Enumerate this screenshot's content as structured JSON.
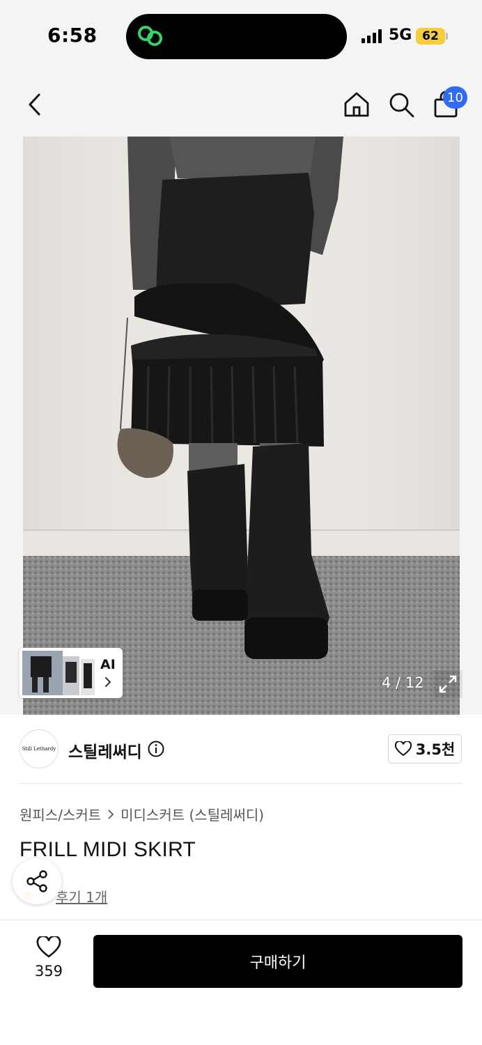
{
  "status_bar": {
    "time": "6:58",
    "network": "5G",
    "battery": "62",
    "island_icon": "link-rings-icon"
  },
  "nav": {
    "back_icon": "chevron-left-icon",
    "home_icon": "home-icon",
    "search_icon": "search-icon",
    "cart_icon": "shopping-bag-icon",
    "cart_badge": "10"
  },
  "gallery": {
    "counter": "4 / 12",
    "ai_label": "AI",
    "expand_icon": "expand-icon"
  },
  "brand": {
    "logo_text": "Still Lethardy",
    "name": "스틸레써디",
    "likes": "3.5천"
  },
  "product": {
    "breadcrumb": [
      "원피스/스커트",
      "미디스커트 (스틸레써디)"
    ],
    "title": "FRILL MIDI SKIRT",
    "review_link": "후기 1개"
  },
  "bottom_bar": {
    "wish_count": "359",
    "buy_label": "구매하기"
  },
  "colors": {
    "header_bg": "#f4f4f4",
    "badge_blue": "#2f6cf2",
    "battery_yellow": "#f6cd3a",
    "buy_button": "#000000"
  }
}
